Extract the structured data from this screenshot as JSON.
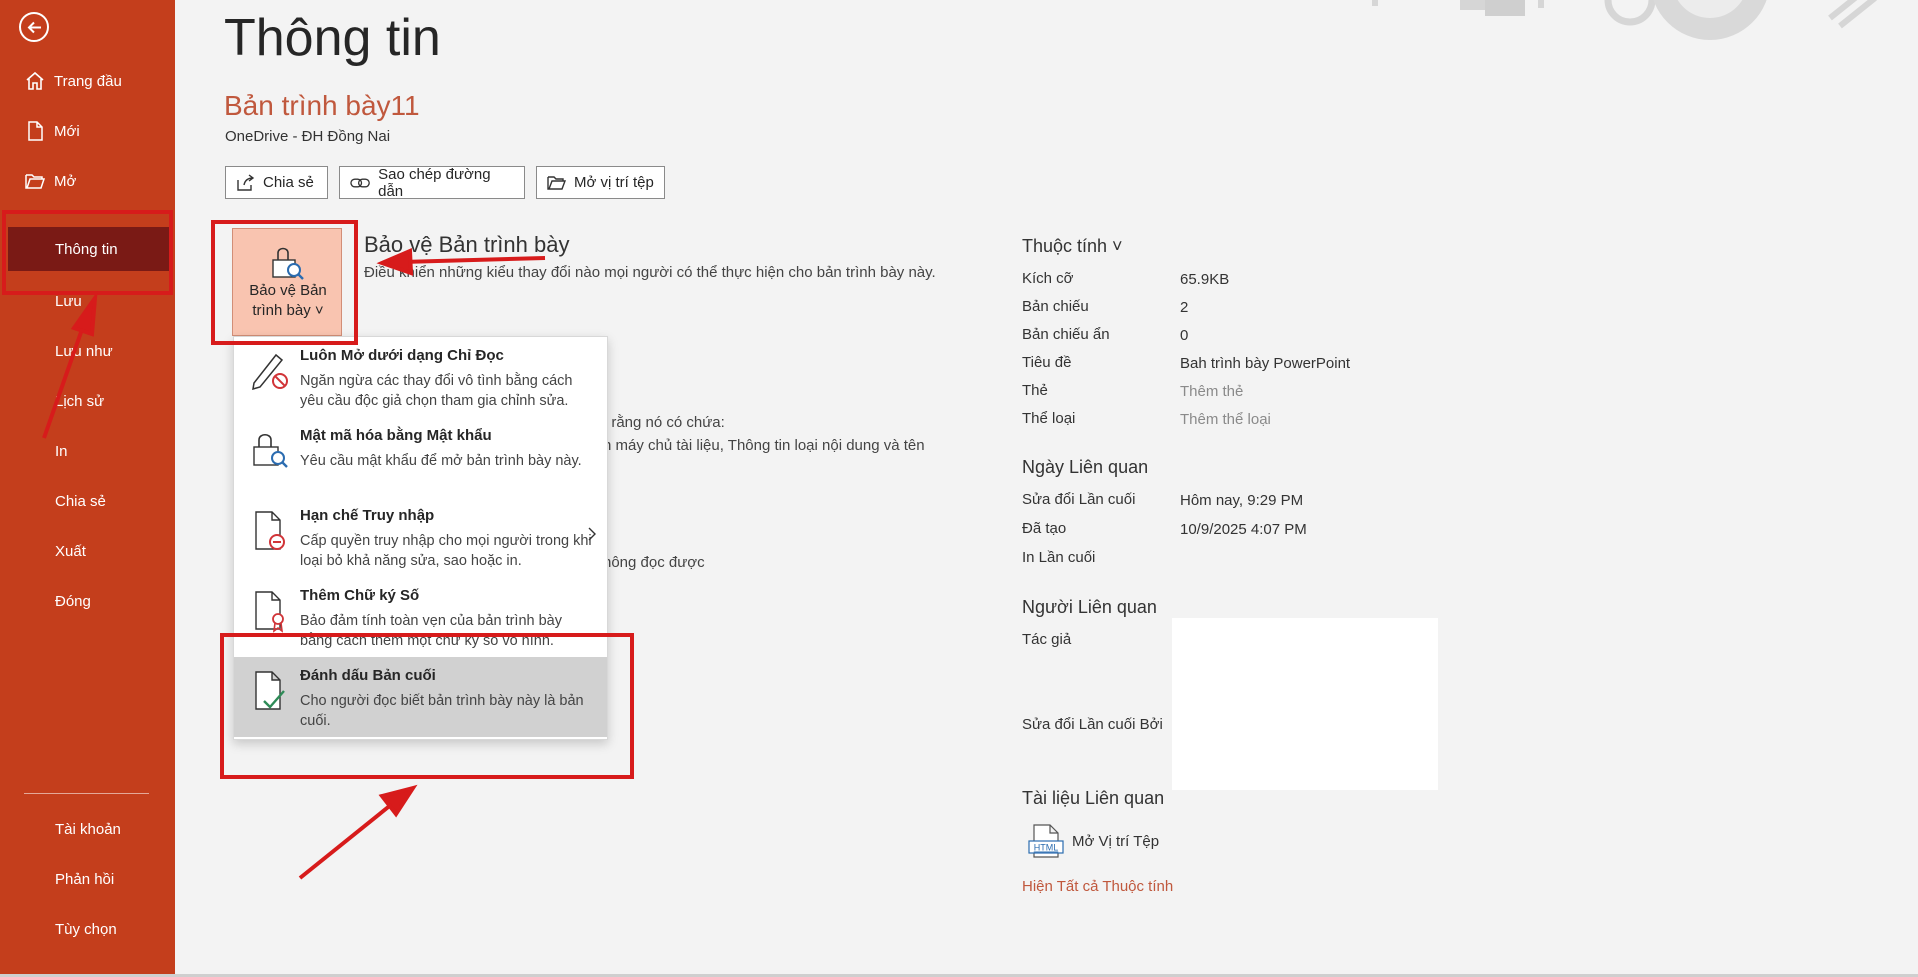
{
  "sidebar": {
    "items_top": [
      {
        "label": "Trang đầu",
        "icon": "home-icon"
      },
      {
        "label": "Mới",
        "icon": "new-document-icon"
      },
      {
        "label": "Mở",
        "icon": "open-folder-icon"
      }
    ],
    "active": "Thông tin",
    "items_mid": [
      "Lưu",
      "Lưu như",
      "Lịch sử",
      "In",
      "Chia sẻ",
      "Xuất",
      "Đóng"
    ],
    "items_bottom": [
      "Tài khoản",
      "Phản hồi",
      "Tùy chọn"
    ]
  },
  "page": {
    "title": "Thông tin",
    "doc_name": "Bản trình bày11",
    "location": "OneDrive - ĐH Đồng Nai"
  },
  "actions": {
    "share": "Chia sẻ",
    "copy_link": "Sao chép đường dẫn",
    "open_location": "Mở vị trí tệp"
  },
  "protect": {
    "tile_line1": "Bảo vệ Bản",
    "tile_line2": "trình bày ˅",
    "heading": "Bảo vệ Bản trình bày",
    "description": "Điều khiển những kiểu thay đổi nào mọi người có thể thực hiện cho bản trình bày này."
  },
  "background_text": {
    "line1": "t rằng nó có chứa:",
    "line2": "n máy chủ tài liệu, Thông tin loại nội dung và tên",
    "line3": "hông đọc được"
  },
  "menu": [
    {
      "title": "Luôn Mở dưới dạng Chỉ Đọc",
      "desc": "Ngăn ngừa các thay đổi vô tình bằng cách yêu cầu độc giả chọn tham gia chỉnh sửa.",
      "icon": "pencil-no-icon"
    },
    {
      "title": "Mật mã hóa bằng Mật khẩu",
      "desc": "Yêu cầu mật khẩu để mở bản trình bày này.",
      "icon": "lock-key-icon"
    },
    {
      "title": "Hạn chế Truy nhập",
      "desc": "Cấp quyền truy nhập cho mọi người trong khi loại bỏ khả năng sửa, sao hoặc in.",
      "icon": "restrict-document-icon"
    },
    {
      "title": "Thêm Chữ ký Số",
      "desc": "Bảo đảm tính toàn vẹn của bản trình bày bằng cách thêm một chữ ký số vô hình.",
      "icon": "signature-document-icon"
    },
    {
      "title": "Đánh dấu Bản cuối",
      "desc": "Cho người đọc biết bản trình bày này là bản cuối.",
      "icon": "final-document-icon"
    }
  ],
  "properties": {
    "heading": "Thuộc tính ˅",
    "rows": [
      {
        "label": "Kích cỡ",
        "value": "65.9KB"
      },
      {
        "label": "Bản chiếu",
        "value": "2"
      },
      {
        "label": "Bản chiếu ẩn",
        "value": "0"
      },
      {
        "label": "Tiêu đề",
        "value": "Bah trình bày PowerPoint"
      },
      {
        "label": "Thẻ",
        "value": "Thêm thẻ"
      },
      {
        "label": "Thể loại",
        "value": "Thêm thể loại"
      }
    ]
  },
  "dates": {
    "heading": "Ngày Liên quan",
    "rows": [
      {
        "label": "Sửa đổi Lần cuối",
        "value": "Hôm nay, 9:29 PM"
      },
      {
        "label": "Đã tạo",
        "value": "10/9/2025 4:07 PM"
      },
      {
        "label": "In Lần cuối",
        "value": ""
      }
    ]
  },
  "people": {
    "heading": "Người Liên quan",
    "author_label": "Tác giả",
    "modified_by_label": "Sửa đổi Lần cuối Bởi"
  },
  "documents": {
    "heading": "Tài liệu Liên quan",
    "open_location": "Mở Vị trí Tệp",
    "file_icon_text": "HTML",
    "show_all": "Hiện Tất cả Thuộc tính"
  },
  "colors": {
    "sidebar": "#c43e1c",
    "sidebar_active": "#7a1a15",
    "accent_text": "#c0583d",
    "annotation": "#d71b1b"
  }
}
